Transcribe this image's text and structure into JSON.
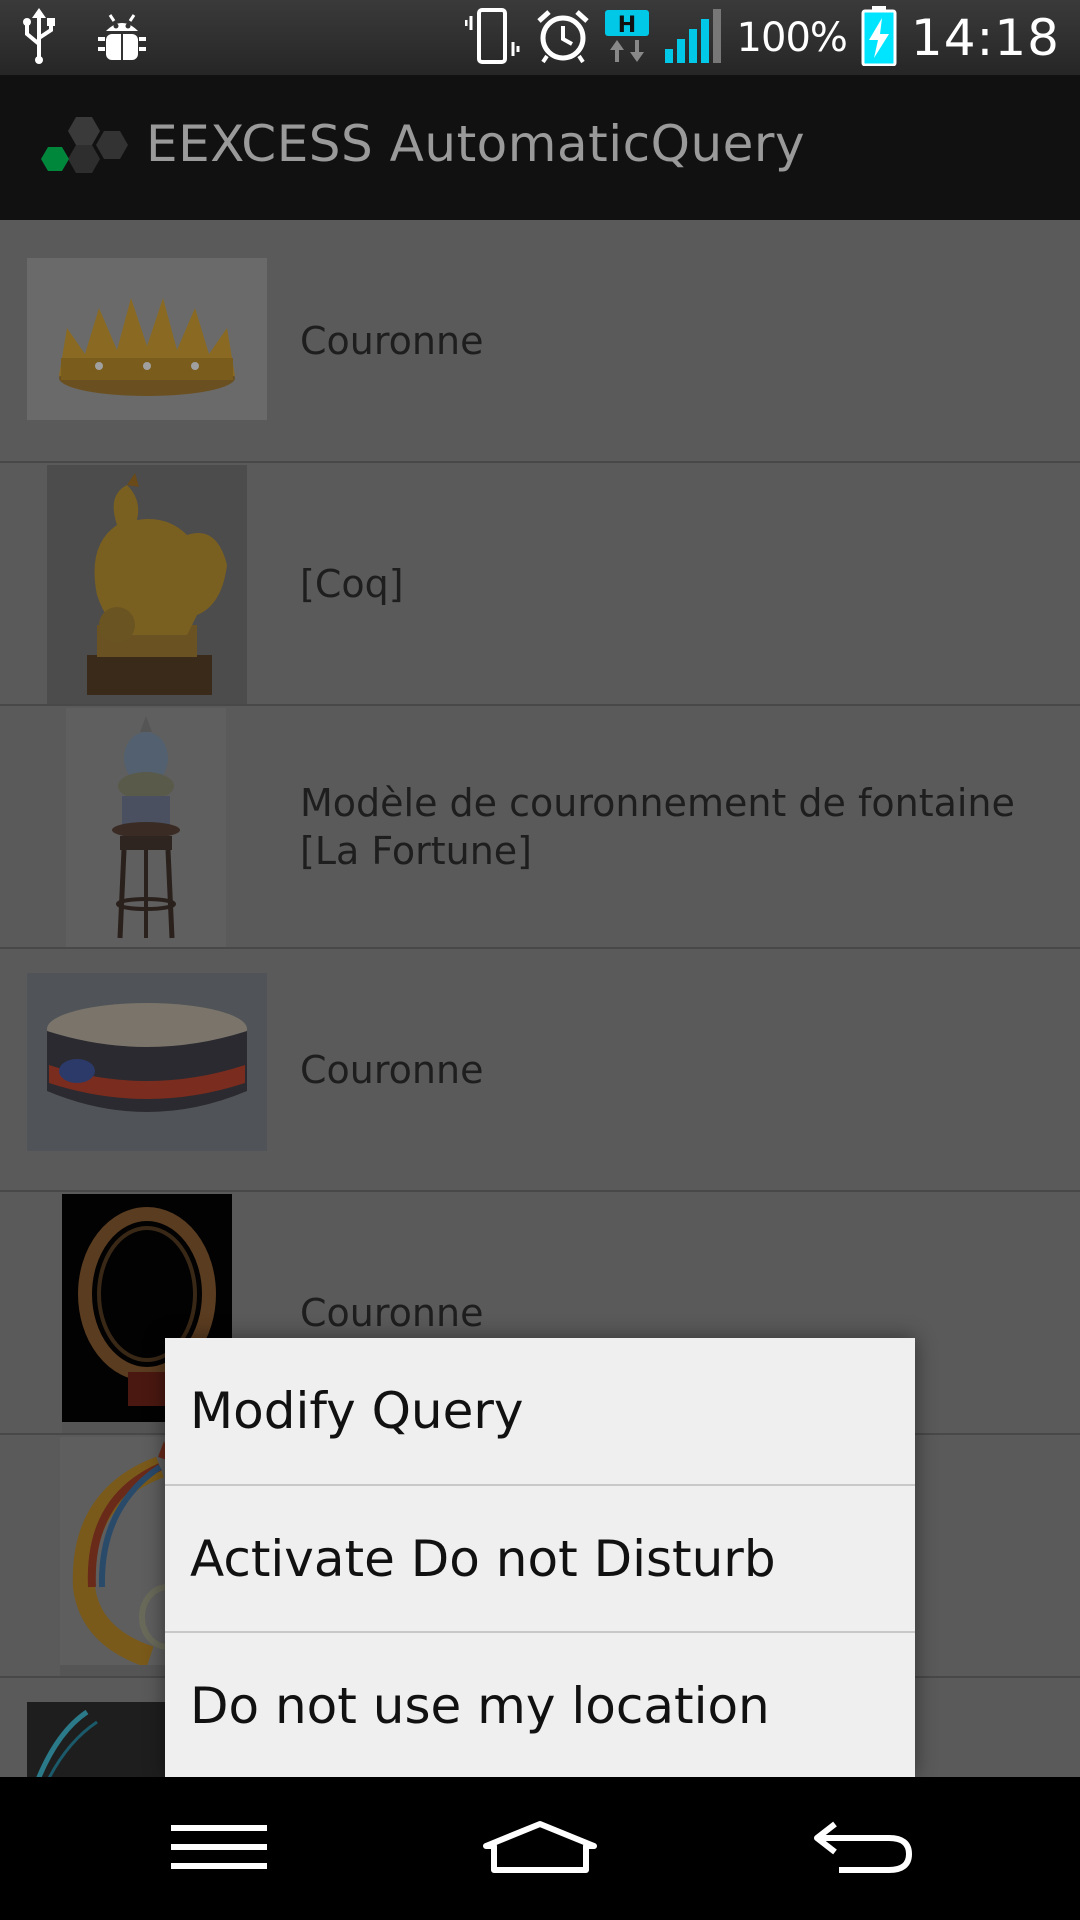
{
  "status_bar": {
    "battery_percent": "100%",
    "time": "14:18",
    "network_type": "H",
    "icons": [
      "usb-icon",
      "debug-icon",
      "vibrate-icon",
      "alarm-icon",
      "network-h-icon",
      "signal-icon",
      "battery-charging-icon"
    ]
  },
  "action_bar": {
    "title": "EEXCESS AutomaticQuery",
    "logo_icon": "eexcess-logo-icon"
  },
  "results": [
    {
      "label": "Couronne",
      "thumb": "crown-gold-thumb"
    },
    {
      "label": "[Coq]",
      "thumb": "rooster-statue-thumb"
    },
    {
      "label": "Modèle de couronnement de fontaine [La Fortune]",
      "thumb": "fountain-model-thumb"
    },
    {
      "label": "Couronne",
      "thumb": "feather-crown-thumb"
    },
    {
      "label": "Couronne",
      "thumb": "necklace-crown-thumb"
    },
    {
      "label": "",
      "thumb": "feather-headdress-thumb"
    },
    {
      "label": "",
      "thumb": "blue-feather-thumb"
    }
  ],
  "context_menu": {
    "items": [
      "Modify Query",
      "Activate Do not Disturb",
      "Do not use my location"
    ]
  },
  "nav_bar": {
    "icons": [
      "menu-icon",
      "home-icon",
      "back-icon"
    ]
  },
  "colors": {
    "accent_cyan": "#00c8e6",
    "logo_green": "#00873c",
    "dim_overlay_list": "#5a5a5a",
    "dialog_bg": "#efefef"
  }
}
